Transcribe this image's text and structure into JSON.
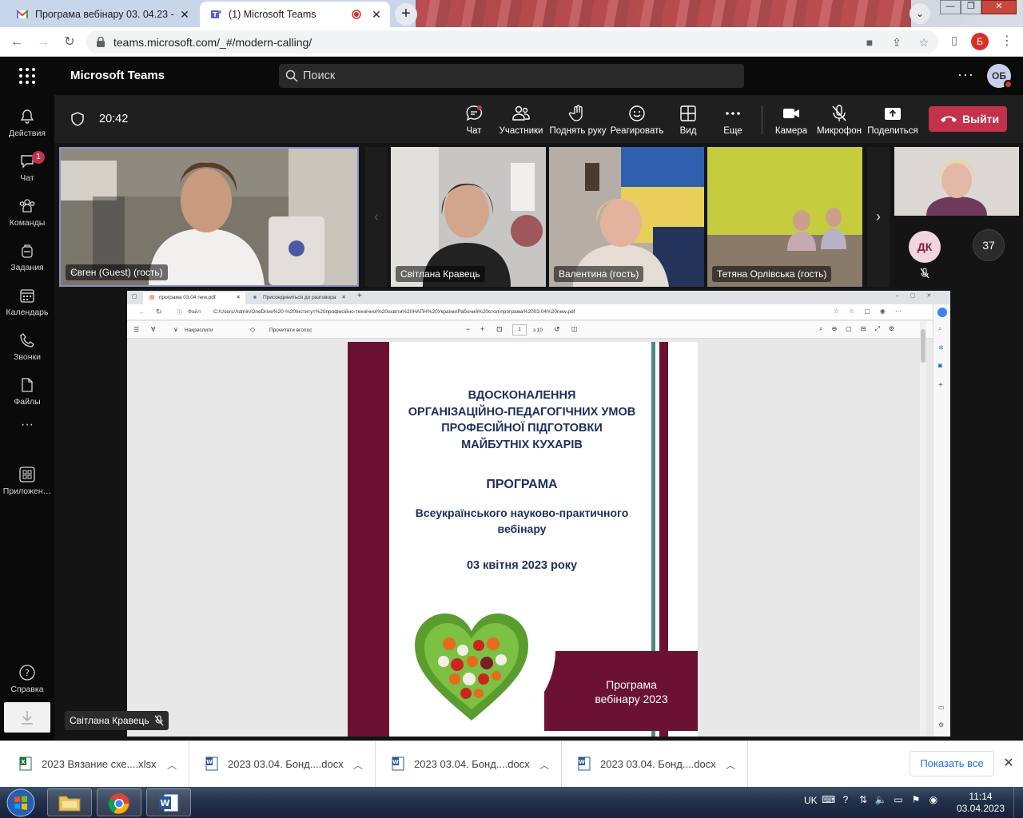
{
  "browser": {
    "tabs": [
      {
        "title": "Програма вебінару 03. 04.23 - o",
        "favicon": "gmail-icon"
      },
      {
        "title": "(1) Microsoft Teams",
        "favicon": "teams-icon"
      }
    ],
    "url": "teams.microsoft.com/_#/modern-calling/",
    "profile_initial": "Б"
  },
  "teams": {
    "app_title": "Microsoft Teams",
    "search_placeholder": "Поиск",
    "avatar_initials": "ОБ"
  },
  "rail": {
    "items": [
      {
        "label": "Действия",
        "icon": "bell-icon"
      },
      {
        "label": "Чат",
        "icon": "chat-icon",
        "badge": "1"
      },
      {
        "label": "Команды",
        "icon": "teams-people-icon"
      },
      {
        "label": "Задания",
        "icon": "backpack-icon"
      },
      {
        "label": "Календарь",
        "icon": "calendar-icon"
      },
      {
        "label": "Звонки",
        "icon": "phone-icon"
      },
      {
        "label": "Файлы",
        "icon": "file-icon"
      },
      {
        "label": "Приложен…",
        "icon": "apps-icon"
      },
      {
        "label": "Справка",
        "icon": "help-icon"
      }
    ]
  },
  "meeting": {
    "timer": "20:42",
    "controls": [
      {
        "label": "Чат",
        "icon": "chat-bubble-icon"
      },
      {
        "label": "Участники",
        "icon": "participants-icon"
      },
      {
        "label": "Поднять руку",
        "icon": "hand-icon"
      },
      {
        "label": "Реагировать",
        "icon": "smile-icon"
      },
      {
        "label": "Вид",
        "icon": "grid-view-icon"
      },
      {
        "label": "Еще",
        "icon": "more-icon"
      },
      {
        "label": "Камера",
        "icon": "camera-icon"
      },
      {
        "label": "Микрофон",
        "icon": "mic-off-icon"
      },
      {
        "label": "Поделиться",
        "icon": "share-icon"
      }
    ],
    "leave_label": "Выйти",
    "participants": [
      {
        "name": "Євген (Guest) (гость)"
      },
      {
        "name": "Світлана Кравець"
      },
      {
        "name": "Валентина (гость)"
      },
      {
        "name": "Тетяна Орлівська (гость)"
      }
    ],
    "dk_initials": "ДК",
    "more_count": "37",
    "speaker_label": "Світлана Кравець"
  },
  "shared_screen": {
    "tabs": [
      "програма 03.04 new.pdf",
      "Присоединиться до разговора"
    ],
    "file_label": "Файл",
    "url": "C:/Users/Admin/OneDrive%20-%20Інститут%20професійно-технічної%20освіти%20НАПН%20України/Рабочий%20стол/програма%2003.04%20new.pdf",
    "draw_label": "Накреслити",
    "read_label": "Прочитати вголос",
    "page_current": "1",
    "page_total": "з 10"
  },
  "pdf": {
    "title_lines": [
      "ВДОСКОНАЛЕННЯ",
      "ОРГАНІЗАЦІЙНО-ПЕДАГОГІЧНИХ УМОВ",
      "ПРОФЕСІЙНОЇ ПІДГОТОВКИ",
      "МАЙБУТНІХ КУХАРІВ"
    ],
    "program": "ПРОГРАМА",
    "subtitle_lines": [
      "Всеукраїнського науково-практичного",
      "вебінару"
    ],
    "date": "03 квітня 2023 року",
    "footer_lines": [
      "Програма",
      "вебінару 2023"
    ],
    "colors": {
      "maroon": "#6b1232",
      "green": "#4c8a80",
      "navy": "#1d2f5a"
    }
  },
  "downloads": {
    "items": [
      {
        "name": "2023 Вязание схе....xlsx",
        "icon": "excel-icon"
      },
      {
        "name": "2023 03.04. Бонд....docx",
        "icon": "word-icon"
      },
      {
        "name": "2023 03.04. Бонд....docx",
        "icon": "word-icon"
      },
      {
        "name": "2023 03.04. Бонд....docx",
        "icon": "word-icon"
      }
    ],
    "show_all": "Показать все"
  },
  "taskbar": {
    "lang": "UK",
    "time": "11:14",
    "date": "03.04.2023"
  }
}
